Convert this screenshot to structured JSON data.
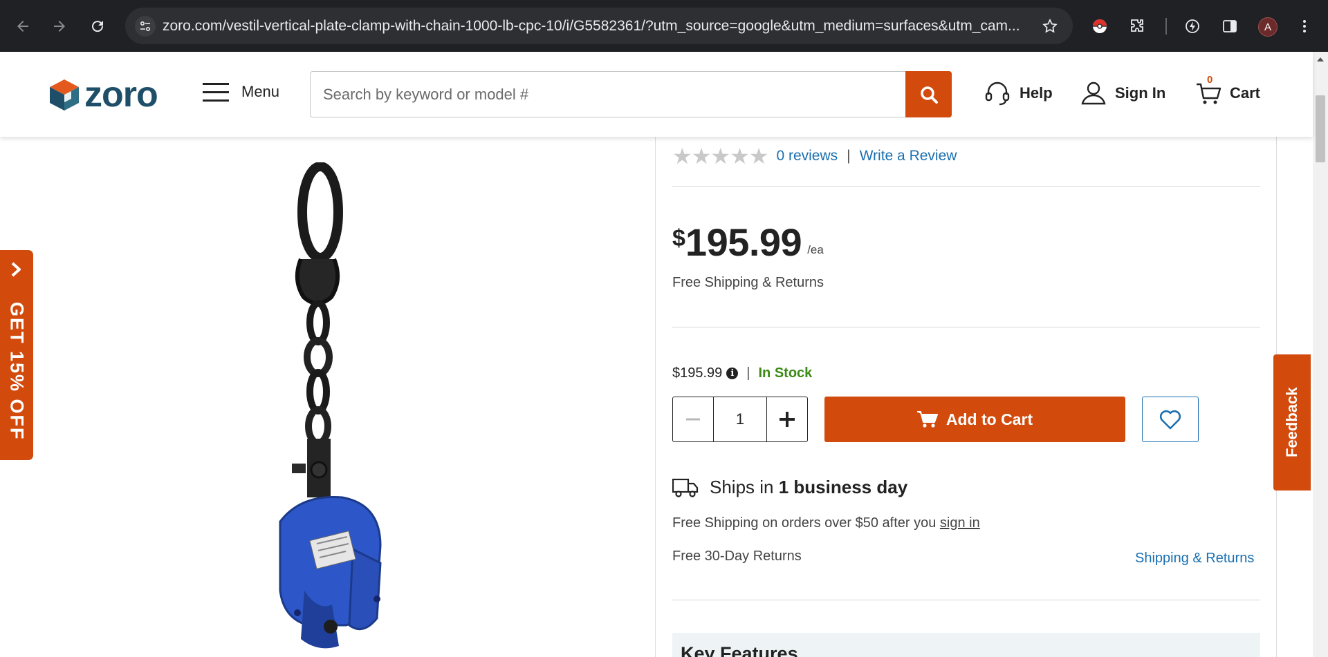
{
  "browser": {
    "url": "zoro.com/vestil-vertical-plate-clamp-with-chain-1000-lb-cpc-10/i/G5582361/?utm_source=google&utm_medium=surfaces&utm_cam...",
    "profile_initial": "A"
  },
  "header": {
    "logo_text": "zoro",
    "menu_label": "Menu",
    "search_placeholder": "Search by keyword or model #",
    "help_label": "Help",
    "sign_in_label": "Sign In",
    "cart_label": "Cart",
    "cart_count": "0"
  },
  "product": {
    "stars": "★★★★★",
    "reviews_label": "0 reviews",
    "write_review_label": "Write a Review",
    "price_currency": "$",
    "price_amount": "195.99",
    "price_unit": "/ea",
    "free_shipping_returns": "Free Shipping & Returns",
    "unit_price": "$195.99",
    "stock_status": "In Stock",
    "quantity": "1",
    "add_to_cart_label": "Add to Cart",
    "ships_prefix": "Ships in ",
    "ships_bold": "1 business day",
    "free_shipping_note": "Free Shipping on orders over $50 after you ",
    "sign_in_link": "sign in",
    "returns_note": "Free 30-Day Returns",
    "shipping_returns_link": "Shipping & Returns",
    "key_features_title": "Key Features"
  },
  "promo": {
    "label": "GET 15% OFF"
  },
  "feedback": {
    "label": "Feedback"
  },
  "colors": {
    "brand_orange": "#d24b0d",
    "brand_blue": "#1f4f68",
    "link_blue": "#1a6fb0",
    "in_stock_green": "#3b8a15"
  }
}
